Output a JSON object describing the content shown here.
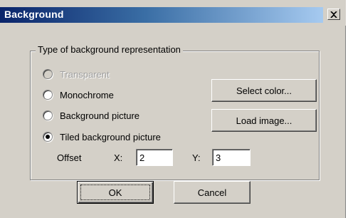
{
  "window": {
    "title": "Background",
    "close_glyph": "×"
  },
  "group": {
    "label": "Type of background representation"
  },
  "radios": [
    {
      "label": "Transparent",
      "checked": false,
      "disabled": true
    },
    {
      "label": "Monochrome",
      "checked": false,
      "disabled": false
    },
    {
      "label": "Background picture",
      "checked": false,
      "disabled": false
    },
    {
      "label": "Tiled background picture",
      "checked": true,
      "disabled": false
    }
  ],
  "buttons": {
    "select_color": "Select color...",
    "load_image": "Load image...",
    "ok": "OK",
    "cancel": "Cancel"
  },
  "offset": {
    "label": "Offset",
    "x_label": "X:",
    "x_value": "2",
    "y_label": "Y:",
    "y_value": "3"
  },
  "colors": {
    "face": "#d4d0c8",
    "title_start": "#0a246a",
    "title_end": "#a6caf0"
  }
}
